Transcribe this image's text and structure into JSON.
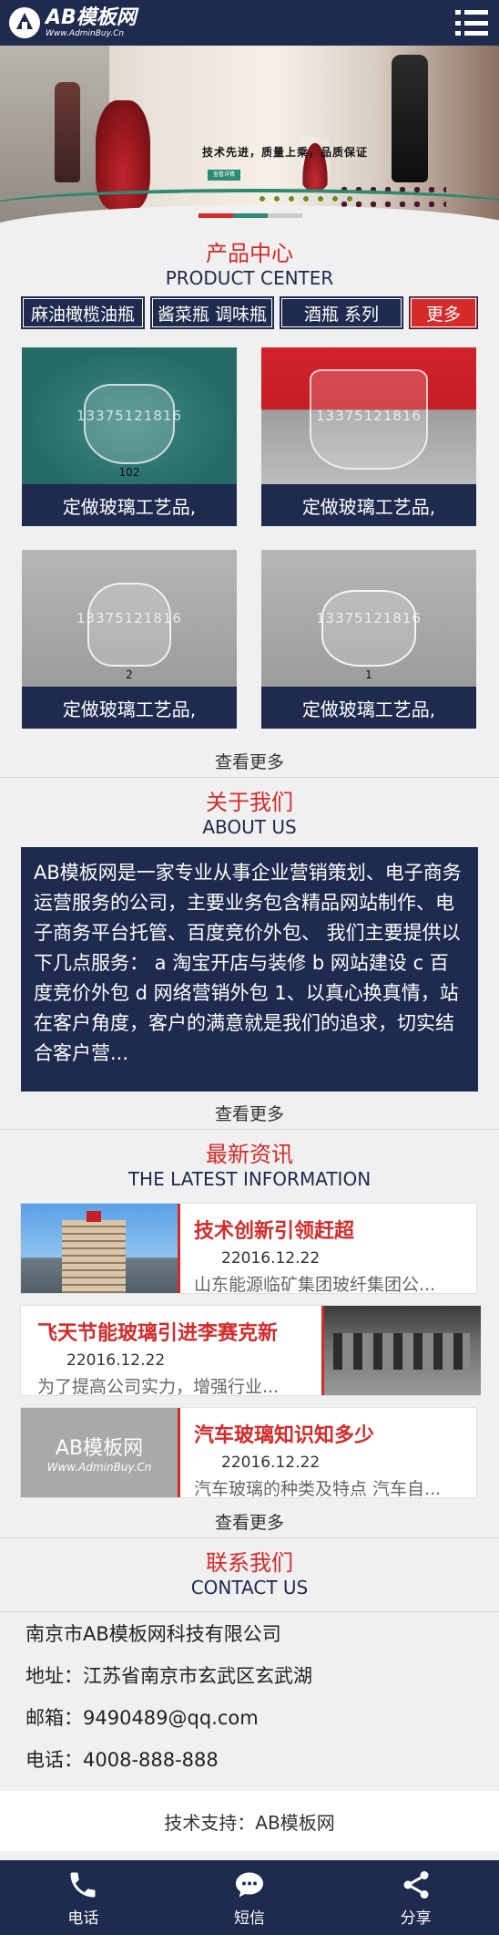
{
  "header": {
    "logo_text": "AB模板网",
    "logo_sub": "Www.AdminBuy.Cn",
    "menu_icon": "menu-icon"
  },
  "banner": {
    "tagline": "技术先进，质量上乘，品质保证",
    "cta": "查看详情"
  },
  "products": {
    "title_cn": "产品中心",
    "title_en": "PRODUCT CENTER",
    "categories": [
      "麻油橄榄油瓶",
      "酱菜瓶 调味瓶",
      "酒瓶 系列"
    ],
    "more_label": "更多",
    "items": [
      {
        "caption": "定做玻璃工艺品,",
        "watermark": "13375121816",
        "num": "102"
      },
      {
        "caption": "定做玻璃工艺品,",
        "watermark": "13375121816",
        "num": ""
      },
      {
        "caption": "定做玻璃工艺品,",
        "watermark": "13375121816",
        "num": "2"
      },
      {
        "caption": "定做玻璃工艺品,",
        "watermark": "13375121816",
        "num": "1"
      }
    ],
    "view_more": "查看更多"
  },
  "about": {
    "title_cn": "关于我们",
    "title_en": "ABOUT US",
    "text": "AB模板网是一家专业从事企业营销策划、电子商务运营服务的公司，主要业务包含精品网站制作、电子商务平台托管、百度竞价外包、 我们主要提供以下几点服务： a 淘宝开店与装修 b 网站建设 c 百度竞价外包 d 网络营销外包 1、以真心换真情，站在客户角度，客户的满意就是我们的追求，切实结合客户营...",
    "view_more": "查看更多"
  },
  "news": {
    "title_cn": "最新资讯",
    "title_en": "THE LATEST INFORMATION",
    "items": [
      {
        "title": "技术创新引领赶超",
        "date": "22016.12.22",
        "desc": "山东能源临矿集团玻纤集团公..."
      },
      {
        "title": "飞天节能玻璃引进李赛克新",
        "date": "22016.12.22",
        "desc": "为了提高公司实力，增强行业..."
      },
      {
        "title": "汽车玻璃知识知多少",
        "date": "22016.12.22",
        "desc": "汽车玻璃的种类及特点 汽车自..."
      }
    ],
    "logo_l1": "AB模板网",
    "logo_l2": "Www.AdminBuy.Cn",
    "view_more": "查看更多"
  },
  "contact": {
    "title_cn": "联系我们",
    "title_en": "CONTACT US",
    "company": "南京市AB模板网科技有限公司",
    "address": "地址：江苏省南京市玄武区玄武湖",
    "email": "邮箱：9490489@qq.com",
    "phone": "电话：4008-888-888"
  },
  "footer": {
    "support": "技术支持：AB模板网"
  },
  "bottom_nav": [
    {
      "label": "电话",
      "icon": "phone-icon"
    },
    {
      "label": "短信",
      "icon": "chat-icon"
    },
    {
      "label": "分享",
      "icon": "share-icon"
    }
  ],
  "colors": {
    "navy": "#1e2a4e",
    "red": "#d52a2a",
    "teal": "#2e8a73"
  }
}
